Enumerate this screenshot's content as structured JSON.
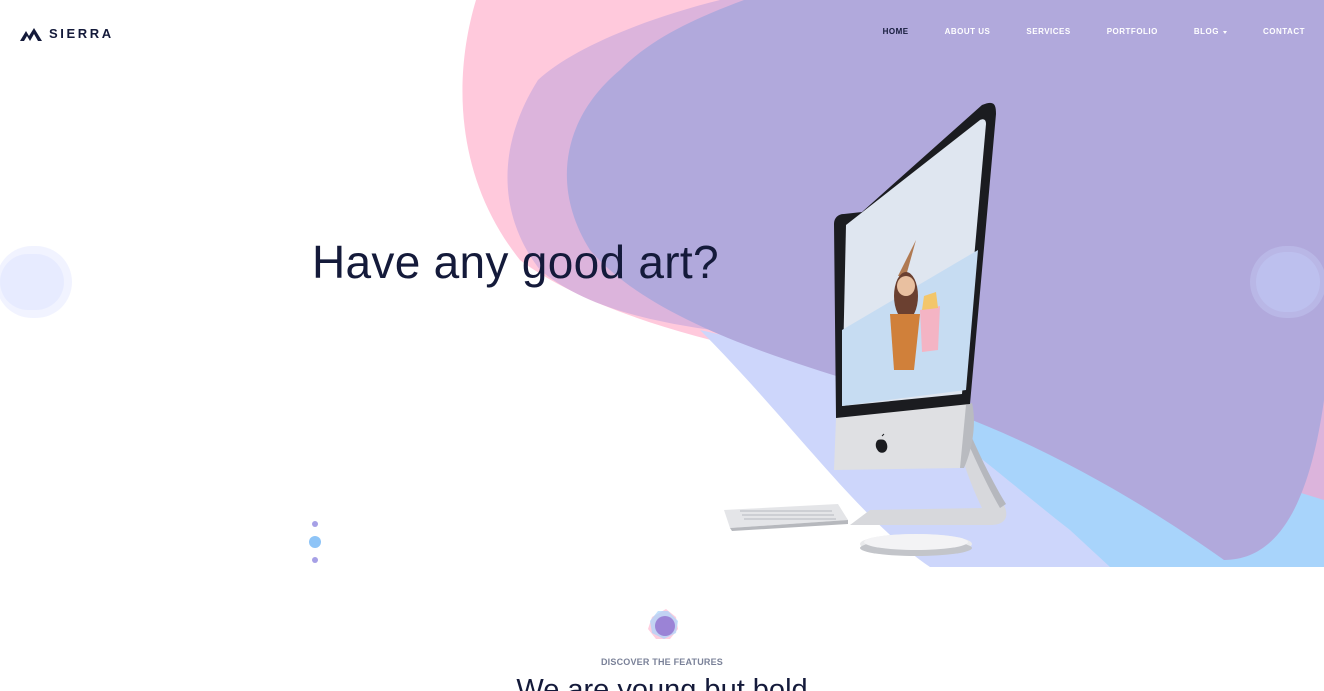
{
  "brand": {
    "name": "SIERRA",
    "logo_icon": "mountain-icon"
  },
  "nav": {
    "items": [
      {
        "label": "HOME",
        "active": true
      },
      {
        "label": "ABOUT US",
        "active": false
      },
      {
        "label": "SERVICES",
        "active": false
      },
      {
        "label": "PORTFOLIO",
        "active": false
      },
      {
        "label": "BLOG",
        "active": false,
        "dropdown": true
      },
      {
        "label": "CONTACT",
        "active": false
      }
    ]
  },
  "hero": {
    "title": "Have any good art?",
    "slides_count": 3,
    "active_slide": 2
  },
  "features": {
    "eyebrow": "DISCOVER THE FEATURES",
    "heading": "We are young but bold"
  },
  "colors": {
    "dark": "#141a3a",
    "pink": "#ffc9dc",
    "lavender": "#b1a9dc",
    "blue": "#a8d4fb",
    "white": "#ffffff"
  }
}
